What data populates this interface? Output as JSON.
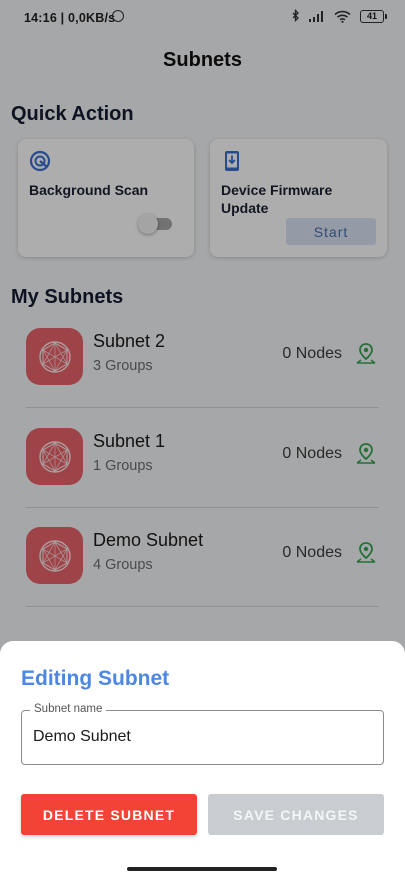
{
  "status_bar": {
    "time": "14:16 | 0,0KB/s",
    "battery": "41"
  },
  "app": {
    "title": "Subnets"
  },
  "quick_action": {
    "title": "Quick Action",
    "background_scan": {
      "label": "Background Scan",
      "icon": "radar-icon",
      "enabled": false
    },
    "firmware_update": {
      "label": "Device Firmware Update",
      "icon": "phone-download-icon",
      "button": "Start"
    }
  },
  "my_subnets": {
    "title": "My Subnets",
    "items": [
      {
        "name": "Subnet 2",
        "groups": "3 Groups",
        "nodes": "0 Nodes"
      },
      {
        "name": "Subnet 1",
        "groups": "1 Groups",
        "nodes": "0 Nodes"
      },
      {
        "name": "Demo Subnet",
        "groups": "4 Groups",
        "nodes": "0 Nodes"
      }
    ]
  },
  "sheet": {
    "title": "Editing Subnet",
    "field_label": "Subnet name",
    "field_value": "Demo Subnet",
    "delete_label": "DELETE SUBNET",
    "save_label": "SAVE CHANGES"
  },
  "colors": {
    "accent": "#4d87e3",
    "danger": "#f24336",
    "subnet_icon": "#e9636a",
    "pin": "#3aa655"
  }
}
